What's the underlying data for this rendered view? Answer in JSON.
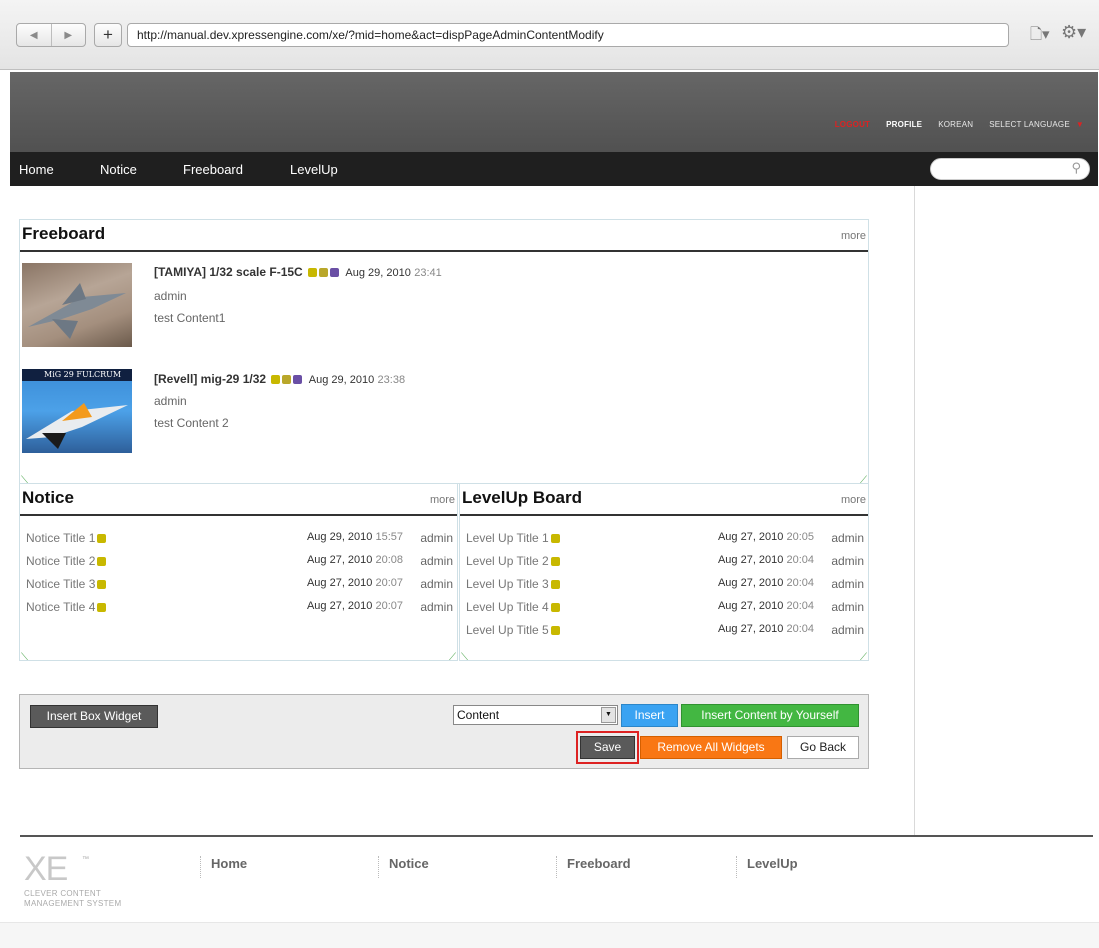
{
  "browser": {
    "url": "http://manual.dev.xpressengine.com/xe/?mid=home&act=dispPageAdminContentModify",
    "back_icon": "back-arrow-icon",
    "forward_icon": "forward-arrow-icon",
    "add_tab_label": "+",
    "page_icon": "page-icon",
    "tools_icon": "gear-icon"
  },
  "header": {
    "links": {
      "logout": "LOGOUT",
      "profile": "PROFILE",
      "korean": "KOREAN",
      "select_language": "SELECT LANGUAGE"
    },
    "nav": [
      "Home",
      "Notice",
      "Freeboard",
      "LevelUp"
    ],
    "search_placeholder": ""
  },
  "freeboard": {
    "title": "Freeboard",
    "more": "more",
    "posts": [
      {
        "title": "[TAMIYA] 1/32 scale F-15C",
        "date": "Aug 29, 2010",
        "time": "23:41",
        "author": "admin",
        "content": "test Content1",
        "thumb_caption": ""
      },
      {
        "title": "[Revell] mig-29 1/32",
        "date": "Aug 29, 2010",
        "time": "23:38",
        "author": "admin",
        "content": "test Content 2",
        "thumb_caption": "MiG 29 FULCRUM"
      }
    ]
  },
  "notice": {
    "title": "Notice",
    "more": "more",
    "rows": [
      {
        "title": "Notice Title 1",
        "date": "Aug 29, 2010",
        "time": "15:57",
        "author": "admin"
      },
      {
        "title": "Notice Title 2",
        "date": "Aug 27, 2010",
        "time": "20:08",
        "author": "admin"
      },
      {
        "title": "Notice Title 3",
        "date": "Aug 27, 2010",
        "time": "20:07",
        "author": "admin"
      },
      {
        "title": "Notice Title 4",
        "date": "Aug 27, 2010",
        "time": "20:07",
        "author": "admin"
      }
    ]
  },
  "levelup": {
    "title": "LevelUp Board",
    "more": "more",
    "rows": [
      {
        "title": "Level Up Title 1",
        "date": "Aug 27, 2010",
        "time": "20:05",
        "author": "admin"
      },
      {
        "title": "Level Up Title 2",
        "date": "Aug 27, 2010",
        "time": "20:04",
        "author": "admin"
      },
      {
        "title": "Level Up Title 3",
        "date": "Aug 27, 2010",
        "time": "20:04",
        "author": "admin"
      },
      {
        "title": "Level Up Title 4",
        "date": "Aug 27, 2010",
        "time": "20:04",
        "author": "admin"
      },
      {
        "title": "Level Up Title 5",
        "date": "Aug 27, 2010",
        "time": "20:04",
        "author": "admin"
      }
    ]
  },
  "controls": {
    "insert_box_widget": "Insert Box Widget",
    "widget_select": "Content",
    "insert": "Insert",
    "insert_content_yourself": "Insert Content by Yourself",
    "save": "Save",
    "remove_all": "Remove All Widgets",
    "go_back": "Go Back"
  },
  "footer": {
    "logo": "XE",
    "logo_tm": "™",
    "tagline_1": "CLEVER CONTENT",
    "tagline_2": "MANAGEMENT SYSTEM",
    "nav": [
      "Home",
      "Notice",
      "Freeboard",
      "LevelUp"
    ]
  },
  "colors": {
    "accent_red": "#dd2222",
    "button_blue": "#3aa3f2",
    "button_green": "#43b742",
    "button_orange": "#f97714",
    "header_dark": "#1f1f1f"
  }
}
